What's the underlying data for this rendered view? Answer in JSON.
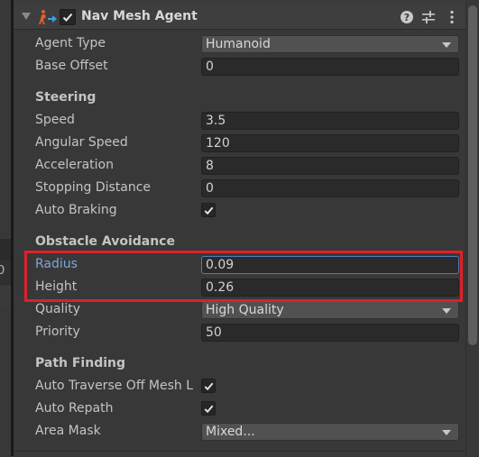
{
  "component": {
    "title": "Nav Mesh Agent",
    "enabled": true,
    "icons": [
      "foldout-arrow-icon",
      "nav-mesh-agent-icon",
      "help-icon",
      "presets-icon",
      "more-options-icon"
    ]
  },
  "left_pane": {
    "partial_value": "0"
  },
  "fields": {
    "agent_type": {
      "label": "Agent Type",
      "value": "Humanoid"
    },
    "base_offset": {
      "label": "Base Offset",
      "value": "0"
    }
  },
  "steering": {
    "header": "Steering",
    "speed": {
      "label": "Speed",
      "value": "3.5"
    },
    "angular_speed": {
      "label": "Angular Speed",
      "value": "120"
    },
    "acceleration": {
      "label": "Acceleration",
      "value": "8"
    },
    "stopping_distance": {
      "label": "Stopping Distance",
      "value": "0"
    },
    "auto_braking": {
      "label": "Auto Braking",
      "checked": true
    }
  },
  "obstacle_avoidance": {
    "header": "Obstacle Avoidance",
    "radius": {
      "label": "Radius",
      "value": "0.09"
    },
    "height": {
      "label": "Height",
      "value": "0.26"
    },
    "quality": {
      "label": "Quality",
      "value": "High Quality"
    },
    "priority": {
      "label": "Priority",
      "value": "50"
    }
  },
  "path_finding": {
    "header": "Path Finding",
    "auto_traverse": {
      "label": "Auto Traverse Off Mesh L",
      "checked": true
    },
    "auto_repath": {
      "label": "Auto Repath",
      "checked": true
    },
    "area_mask": {
      "label": "Area Mask",
      "value": "Mixed..."
    }
  },
  "colors": {
    "highlight": "#e0202a",
    "focus": "#4d7fb5",
    "focused_label": "#7fa6d8",
    "icon_orange": "#e0602a",
    "icon_blue": "#3aa0e0"
  }
}
